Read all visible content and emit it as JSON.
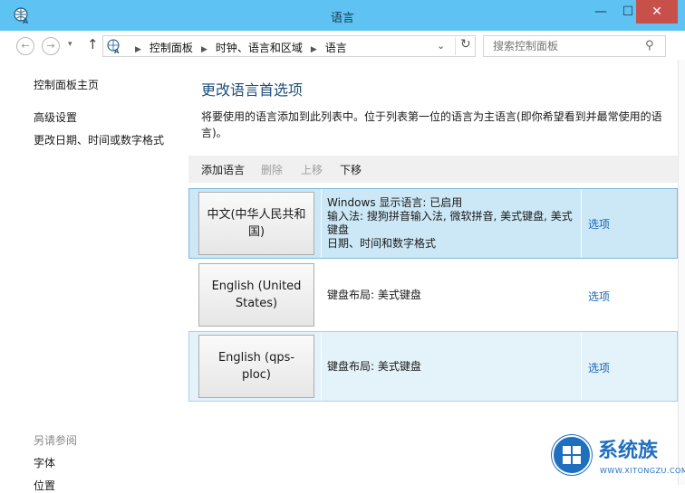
{
  "window": {
    "title": "语言",
    "minimize_glyph": "—",
    "maximize_glyph": "☐",
    "close_glyph": "✕",
    "icon": "language-icon"
  },
  "address_bar": {
    "back_glyph": "←",
    "forward_glyph": "→",
    "up_glyph": "↑",
    "breadcrumb": [
      "控制面板",
      "时钟、语言和区域",
      "语言"
    ],
    "search_placeholder": "搜索控制面板"
  },
  "sidebar": {
    "home_link": "控制面板主页",
    "links": [
      "高级设置",
      "更改日期、时间或数字格式"
    ],
    "see_also_heading": "另请参阅",
    "see_also": [
      "字体",
      "位置"
    ]
  },
  "main": {
    "heading": "更改语言首选项",
    "description": "将要使用的语言添加到此列表中。位于列表第一位的语言为主语言(即你希望看到并最常使用的语言)。",
    "toolbar": {
      "add": "添加语言",
      "remove": "删除",
      "move_up": "上移",
      "move_down": "下移"
    },
    "languages": [
      {
        "name": "中文(中华人民共和国)",
        "info": [
          "Windows 显示语言: 已启用",
          "输入法: 搜狗拼音输入法, 微软拼音, 美式键盘, 美式键盘",
          "日期、时间和数字格式"
        ],
        "options": "选项"
      },
      {
        "name": "English (United States)",
        "info": [
          "键盘布局: 美式键盘"
        ],
        "options": "选项"
      },
      {
        "name": "English (qps-ploc)",
        "info": [
          "键盘布局: 美式键盘"
        ],
        "options": "选项"
      }
    ]
  },
  "watermark": {
    "title": "系统族",
    "subtitle": "WWW.XITONGZU.COM"
  },
  "colors": {
    "titlebar": "#5ec3f2",
    "close_button": "#c7504b",
    "heading": "#1e4e79",
    "link": "#1a65b8",
    "selected_row": "#cce8f6"
  }
}
